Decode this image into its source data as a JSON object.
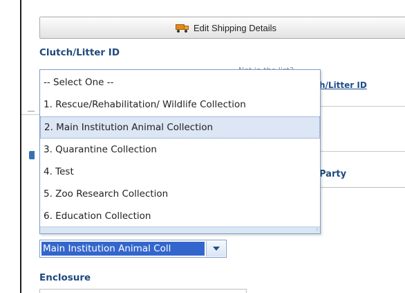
{
  "shipping": {
    "button_label": "Edit Shipping Details",
    "icon": "truck-icon"
  },
  "clutch": {
    "label": "Clutch/Litter ID"
  },
  "background": {
    "not_in_list": "Not in the list?",
    "link_fragment": "h/Litter ID",
    "party_fragment": "Party"
  },
  "collection_dropdown": {
    "options": [
      "-- Select One --",
      "1. Rescue/Rehabilitation/ Wildlife Collection",
      "2. Main Institution Animal Collection",
      "3. Quarantine Collection",
      "4. Test",
      "5. Zoo Research Collection",
      "6. Education Collection"
    ],
    "highlighted_index": 2
  },
  "collection_select": {
    "value": "Main Institution Animal Coll"
  },
  "enclosure": {
    "label": "Enclosure"
  },
  "colors": {
    "accent": "#1f497d",
    "selection": "#3366cc",
    "highlight": "#dce6f4"
  }
}
